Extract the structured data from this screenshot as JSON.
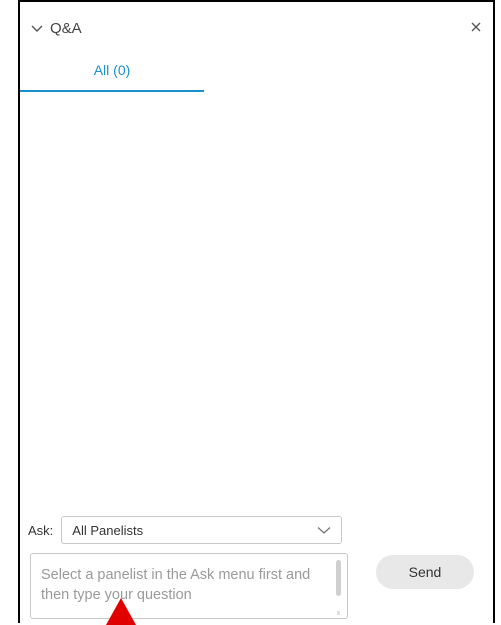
{
  "panel": {
    "title": "Q&A",
    "close_glyph": "×"
  },
  "tabs": [
    {
      "label": "All (0)",
      "active": true
    }
  ],
  "ask": {
    "label": "Ask:",
    "selected": "All Panelists"
  },
  "question": {
    "placeholder": "Select a panelist in the Ask menu first and then type your question",
    "value": ""
  },
  "send": {
    "label": "Send"
  },
  "icons": {
    "collapse": "chevron-down-icon",
    "close": "close-icon",
    "dropdown": "chevron-down-icon",
    "annotation": "red-arrow-icon"
  },
  "colors": {
    "accent": "#1a8fc9",
    "annotation": "#e00000"
  }
}
